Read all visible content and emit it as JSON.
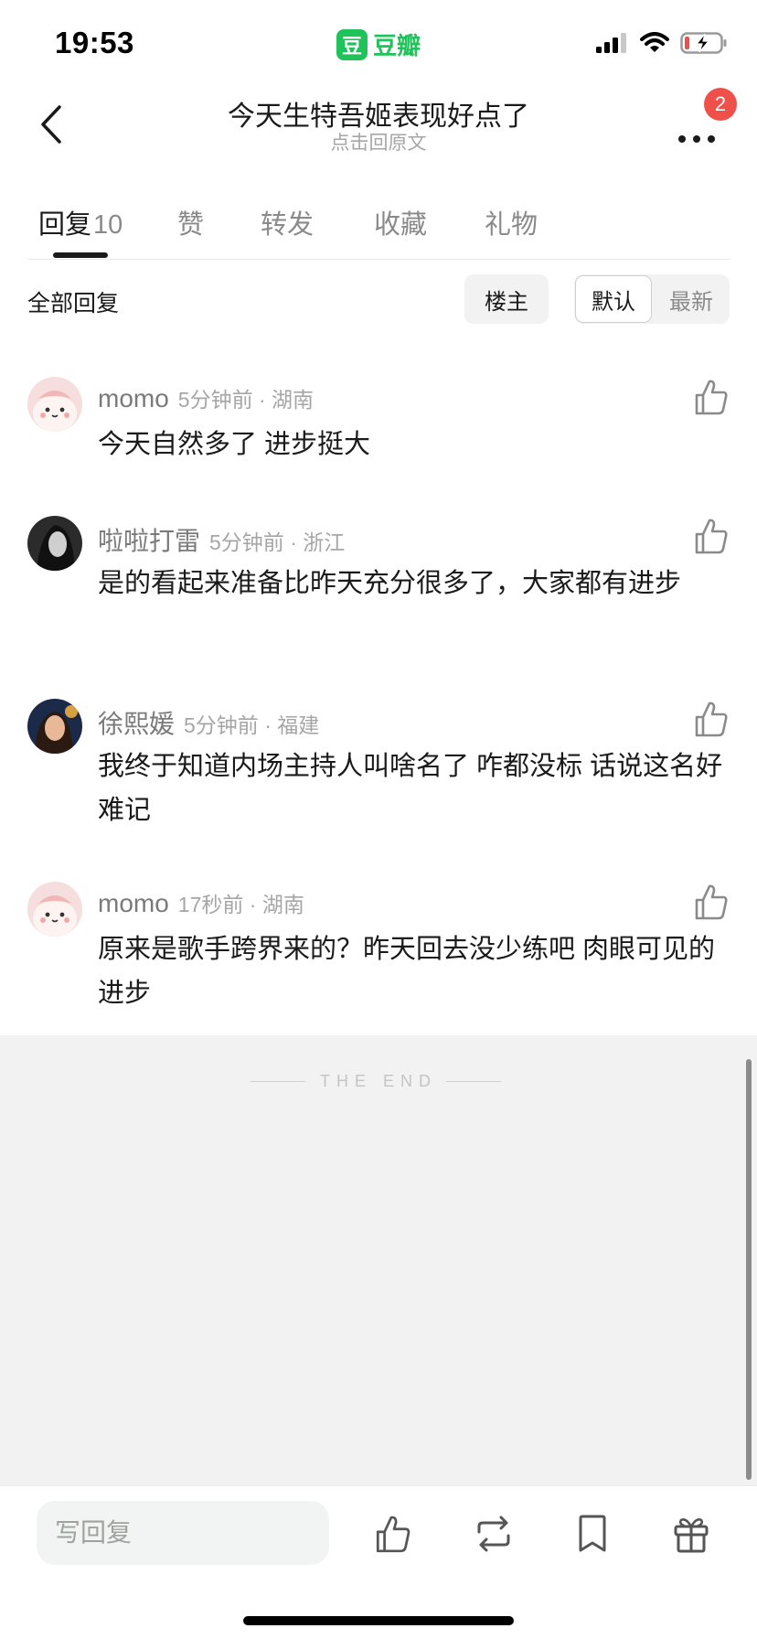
{
  "status_bar": {
    "time": "19:53",
    "app_logo": "豆",
    "app_name": "豆瓣",
    "icons": [
      "cellular-signal-icon",
      "wifi-icon",
      "battery-charging-icon"
    ]
  },
  "nav": {
    "title": "今天生特吾姬表现好点了",
    "subtitle": "点击回原文",
    "notification_count": "2",
    "icons": [
      "back-chevron-icon",
      "more-dots-icon"
    ]
  },
  "tabs": [
    {
      "label": "回复",
      "count": "10",
      "active": true
    },
    {
      "label": "赞"
    },
    {
      "label": "转发"
    },
    {
      "label": "收藏"
    },
    {
      "label": "礼物"
    }
  ],
  "filter": {
    "label": "全部回复",
    "op_button": "楼主",
    "sort_selected": "默认",
    "sort_other": "最新"
  },
  "comments": [
    {
      "user": "momo",
      "meta": "5分钟前 · 湖南",
      "text": "今天自然多了 进步挺大",
      "avatar": "cartoon"
    },
    {
      "user": "啦啦打雷",
      "meta": "5分钟前 · 浙江",
      "text": "是的看起来准备比昨天充分很多了，大家都有进步",
      "avatar": "bw-photo"
    },
    {
      "user": "徐熙媛",
      "meta": "5分钟前 · 福建",
      "text": "我终于知道内场主持人叫啥名了 咋都没标 话说这名好难记",
      "avatar": "color-photo"
    },
    {
      "user": "momo",
      "meta": "17秒前 · 湖南",
      "text": "原来是歌手跨界来的？昨天回去没少练吧 肉眼可见的进步",
      "avatar": "cartoon"
    }
  ],
  "end_text": "THE END",
  "bottom_bar": {
    "reply_placeholder": "写回复",
    "actions": [
      "thumbs-up-icon",
      "repost-icon",
      "bookmark-icon",
      "gift-icon"
    ]
  },
  "colors": {
    "brand_green": "#1fc35a",
    "badge_red": "#f0504a",
    "end_background": "#f2f2f2"
  }
}
